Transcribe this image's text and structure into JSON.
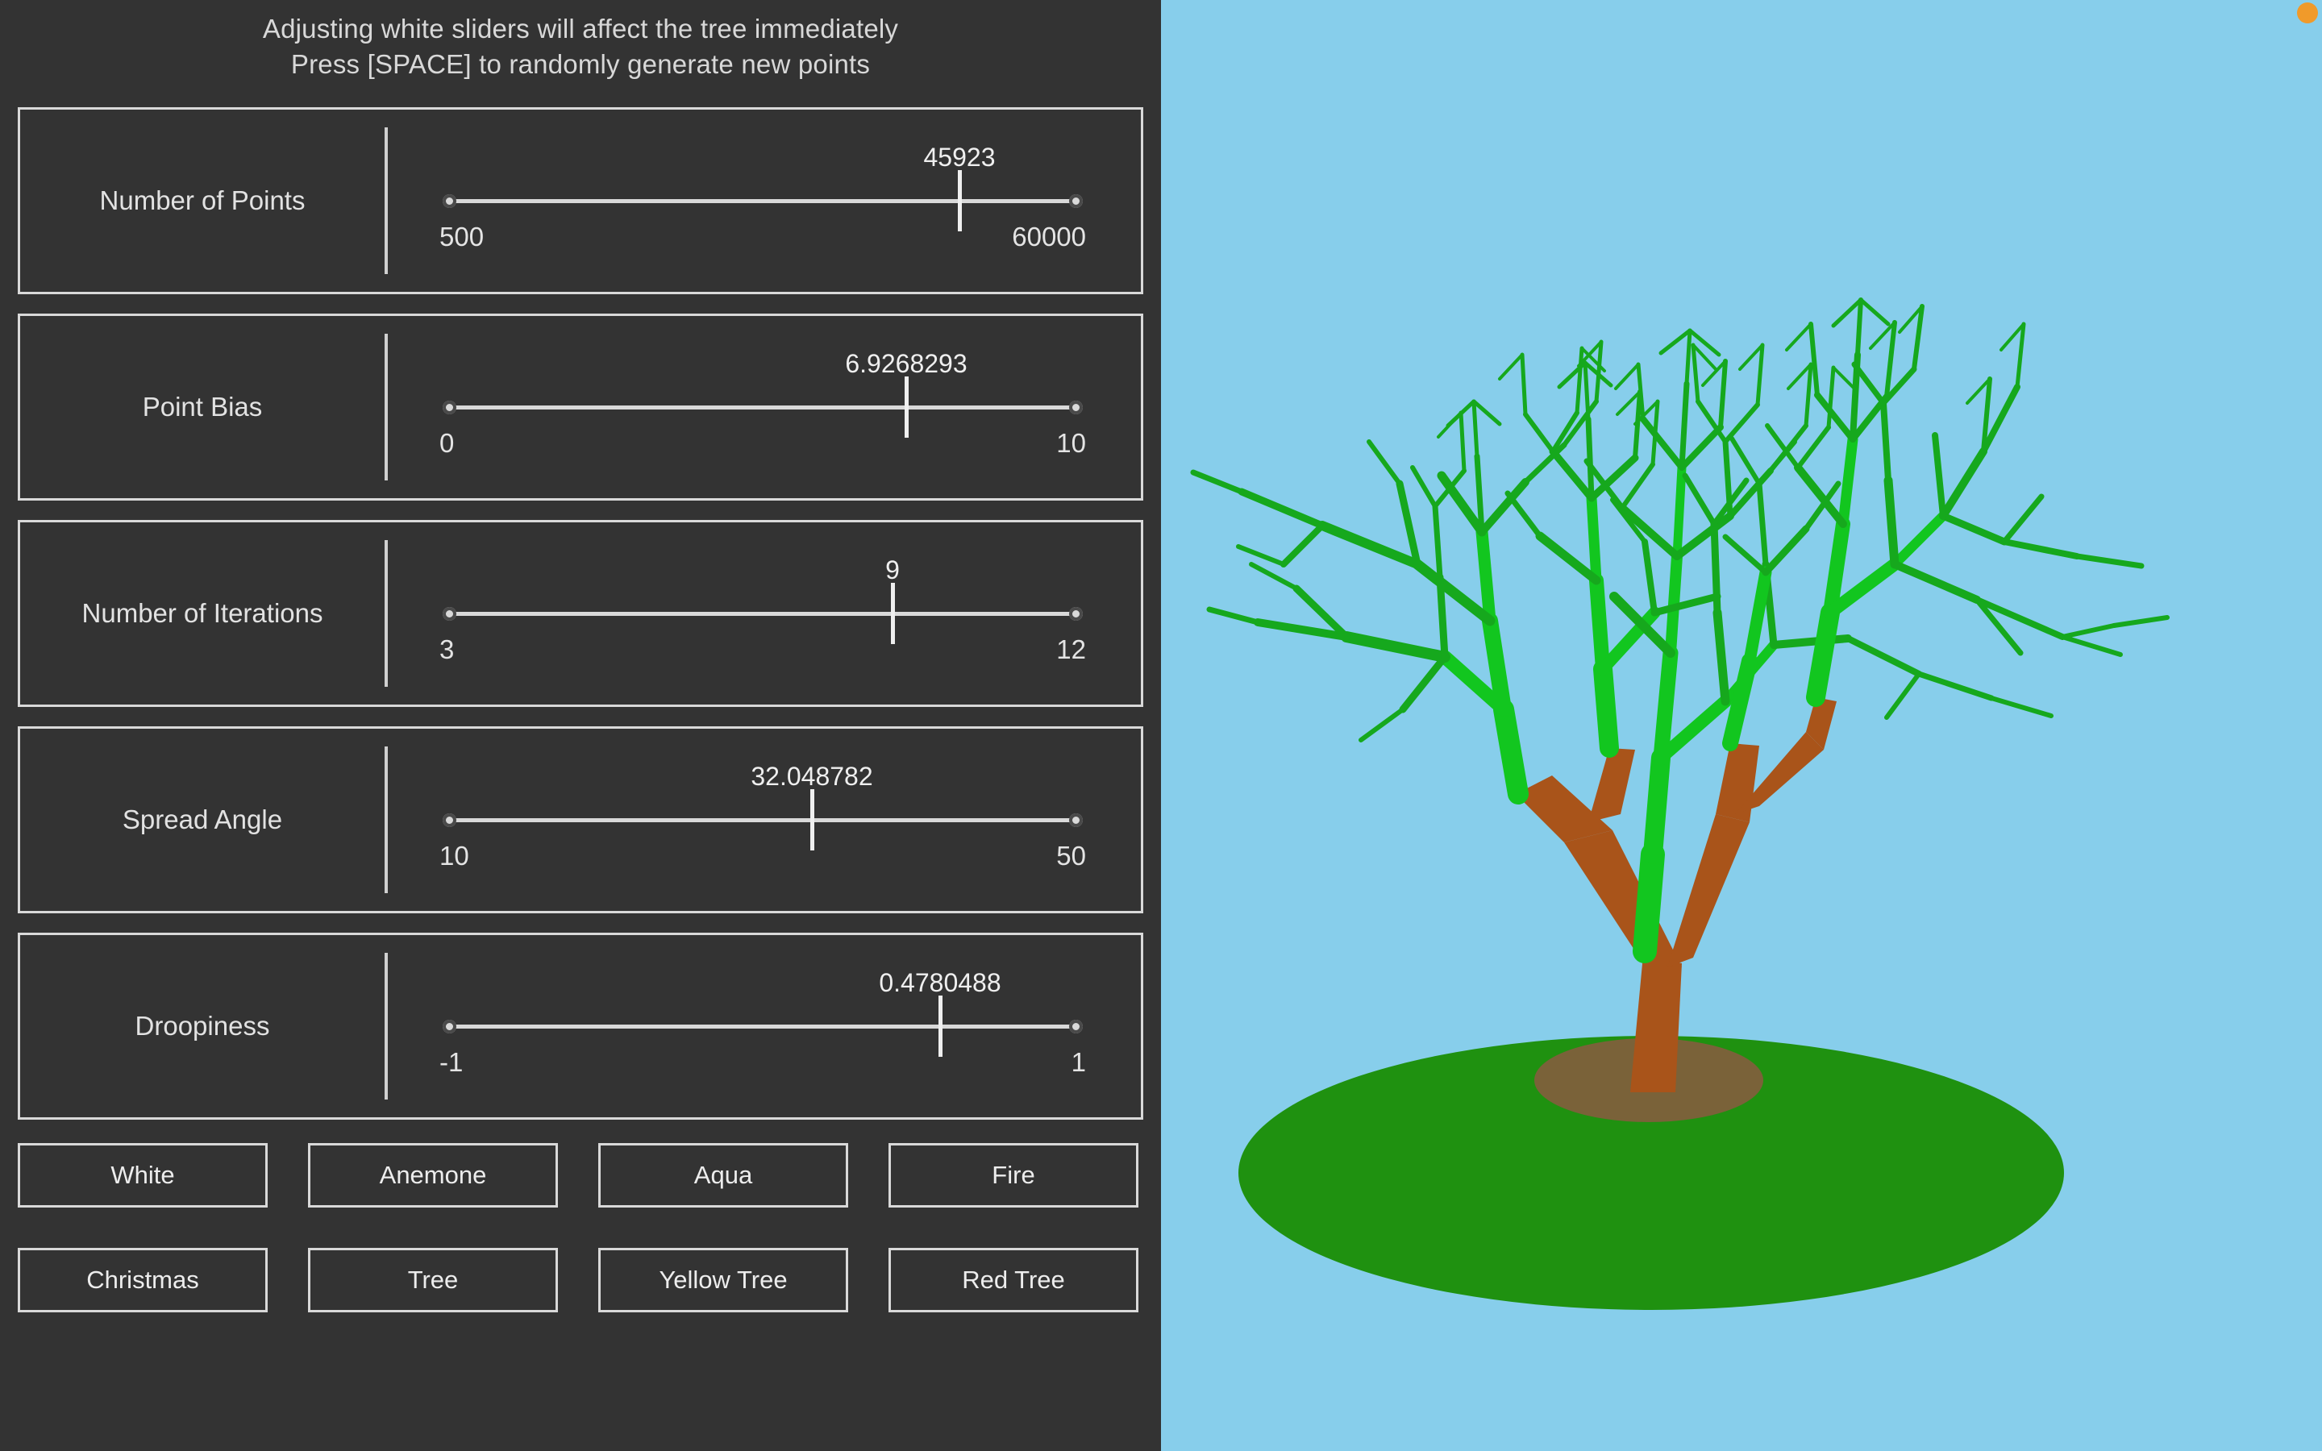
{
  "instructions": {
    "line1": "Adjusting white sliders will affect the tree immediately",
    "line2": "Press [SPACE] to randomly generate new points"
  },
  "sliders": [
    {
      "label": "Number of Points",
      "value": "45923",
      "min": "500",
      "max": "60000",
      "value_num": 45923,
      "min_num": 500,
      "max_num": 60000,
      "fraction": 0.763
    },
    {
      "label": "Point Bias",
      "value": "6.9268293",
      "min": "0",
      "max": "10",
      "value_num": 6.9268293,
      "min_num": 0,
      "max_num": 10,
      "fraction": 0.6927
    },
    {
      "label": "Number of Iterations",
      "value": "9",
      "min": "3",
      "max": "12",
      "value_num": 9,
      "min_num": 3,
      "max_num": 12,
      "fraction": 0.6667
    },
    {
      "label": "Spread Angle",
      "value": "32.048782",
      "min": "10",
      "max": "50",
      "value_num": 32.048782,
      "min_num": 10,
      "max_num": 50,
      "fraction": 0.5512
    },
    {
      "label": "Droopiness",
      "value": "0.4780488",
      "min": "-1",
      "max": "1",
      "value_num": 0.4780488,
      "min_num": -1,
      "max_num": 1,
      "fraction": 0.739
    }
  ],
  "presets": [
    {
      "label": "White"
    },
    {
      "label": "Anemone"
    },
    {
      "label": "Aqua"
    },
    {
      "label": "Fire"
    },
    {
      "label": "Christmas"
    },
    {
      "label": "Tree"
    },
    {
      "label": "Yellow Tree"
    },
    {
      "label": "Red Tree"
    }
  ],
  "viewport": {
    "sky_color": "#87ceeb",
    "ground_color": "#1f9110",
    "shadow_color": "#7a6239",
    "trunk_color": "#a9541a",
    "branch_color": "#12c61f",
    "branch_color_dark": "#16a81d",
    "sun_color": "#f09a2a"
  },
  "theme": {
    "panel_bg": "#333333",
    "page_bg": "#2e2e2e",
    "border": "#d9d9d9",
    "text": "#e4e4e4"
  }
}
